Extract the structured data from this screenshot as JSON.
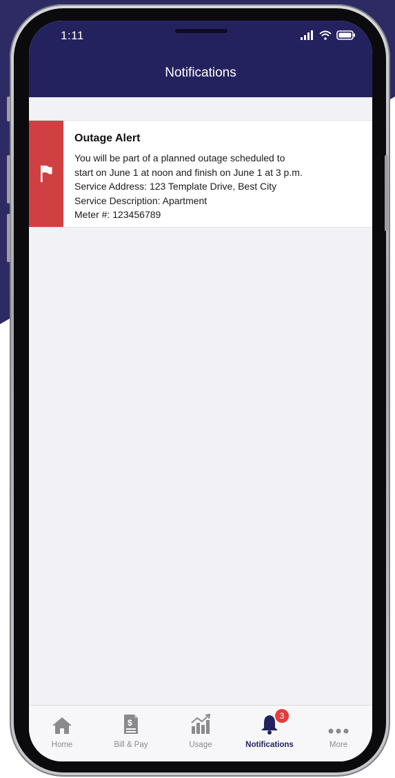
{
  "status_bar": {
    "time": "1:11"
  },
  "header": {
    "title": "Notifications"
  },
  "notifications": [
    {
      "title": "Outage Alert",
      "lines": [
        "You will be part of a planned outage scheduled to",
        "start on June 1 at noon and finish on June 1 at 3 p.m.",
        "Service Address: 123 Template Drive, Best City",
        "Service Description: Apartment",
        "Meter #: 123456789"
      ],
      "accent_color": "#d04042",
      "icon": "flag-icon"
    }
  ],
  "tabbar": {
    "tabs": [
      {
        "label": "Home",
        "icon": "home-icon"
      },
      {
        "label": "Bill & Pay",
        "icon": "bill-icon"
      },
      {
        "label": "Usage",
        "icon": "usage-chart-icon"
      },
      {
        "label": "Notifications",
        "icon": "bell-icon",
        "badge": "3",
        "active": true
      },
      {
        "label": "More",
        "icon": "more-icon"
      }
    ]
  },
  "colors": {
    "brand": "#24225e",
    "alert": "#d04042",
    "badge": "#e53c3c"
  }
}
